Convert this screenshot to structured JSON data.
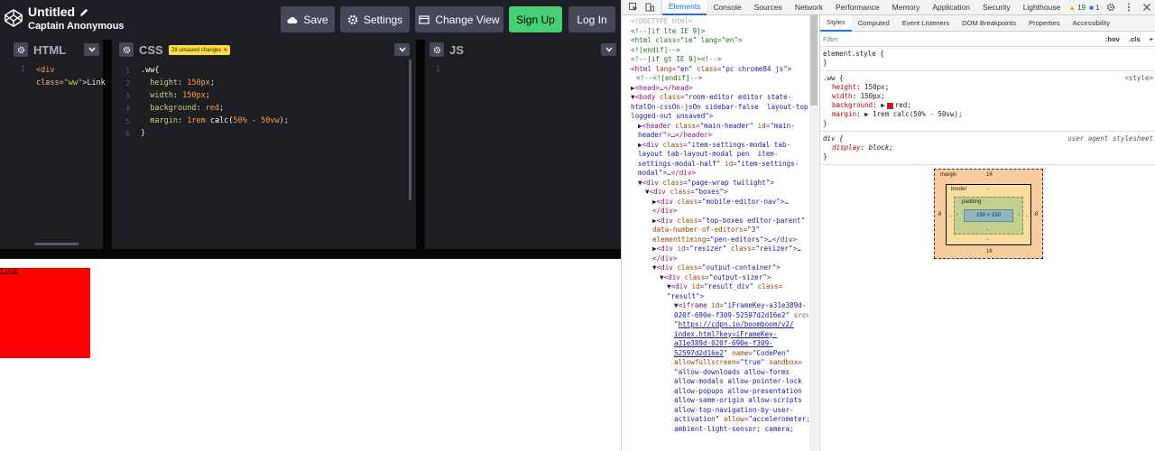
{
  "codepen": {
    "title": "Untitled",
    "author": "Captain Anonymous",
    "buttons": {
      "save": "Save",
      "settings": "Settings",
      "change_view": "Change View",
      "signup": "Sign Up",
      "login": "Log In"
    },
    "editors": {
      "html": {
        "title": "HTML"
      },
      "css": {
        "title": "CSS",
        "badge": "28 unsaved changes"
      },
      "js": {
        "title": "JS"
      }
    },
    "preview_text": "Link"
  },
  "devtools": {
    "tabs": [
      "Elements",
      "Console",
      "Sources",
      "Network",
      "Performance",
      "Memory",
      "Application",
      "Security",
      "Lighthouse"
    ],
    "active_tab": "Elements",
    "warnings": "19",
    "messages": "1",
    "styles_tabs": [
      "Styles",
      "Computed",
      "Event Listeners",
      "DOM Breakpoints",
      "Properties",
      "Accessibility"
    ],
    "filter_placeholder": "Filter",
    "hov": ":hov",
    "cls": ".cls",
    "plus": "+",
    "element_style": "element.style {",
    "ww_source": "<style>",
    "ua_source": "user agent stylesheet",
    "box_model": {
      "margin_label": "margin",
      "border_label": "border",
      "padding_label": "padding",
      "margin_top": "16",
      "margin_bottom": "16",
      "margin_left": "-8",
      "margin_right": "-8",
      "dash": "-",
      "content": "150 × 150"
    }
  }
}
